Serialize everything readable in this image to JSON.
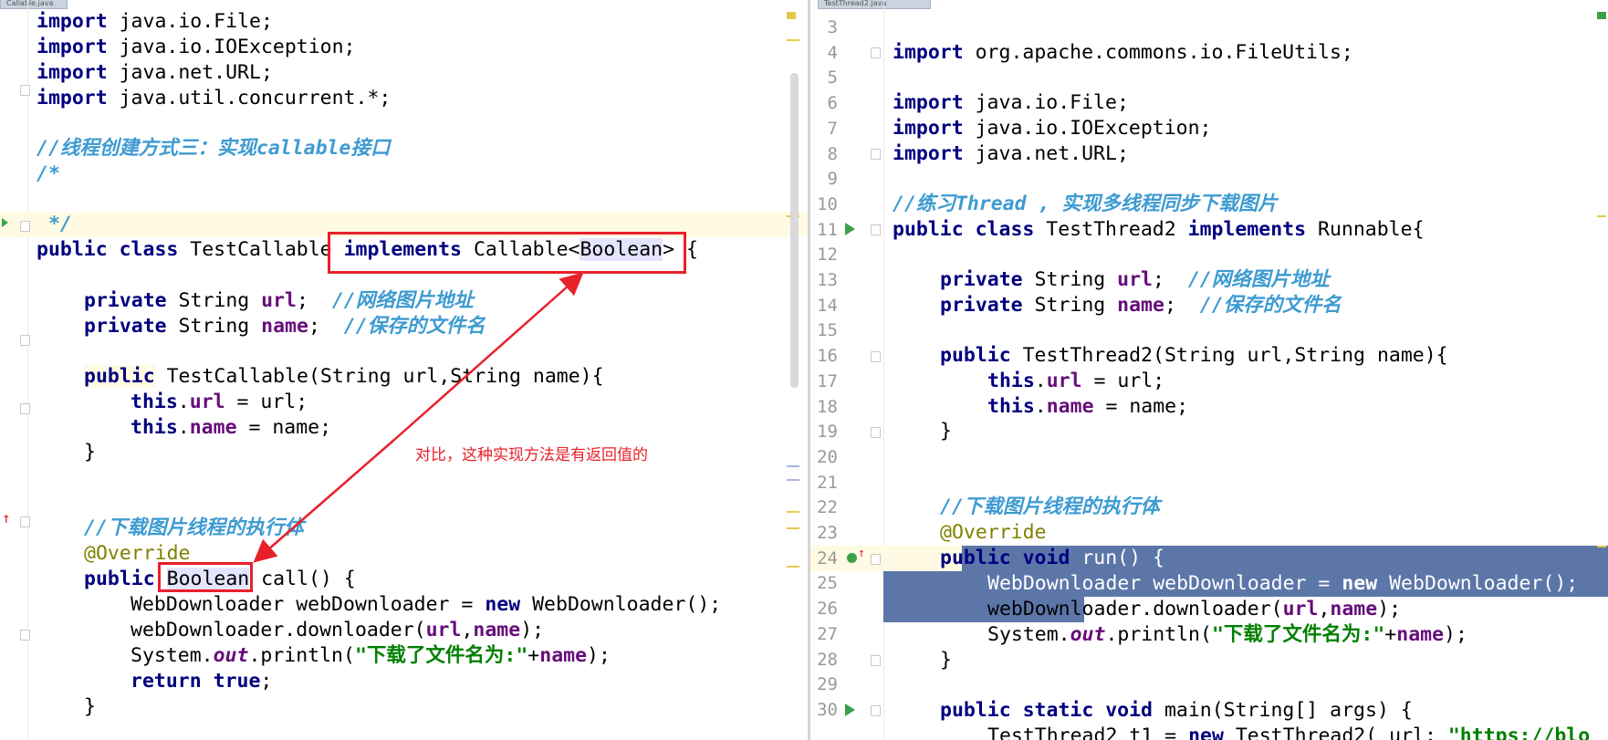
{
  "left_tab": {
    "label": "Callable.java"
  },
  "right_tab": {
    "label": "TestThread2.java"
  },
  "left": {
    "l1": [
      "import",
      " java.io.File;"
    ],
    "l2": [
      "import",
      " java.io.IOException;"
    ],
    "l3": [
      "import",
      " java.net.URL;"
    ],
    "l4": [
      "import",
      " java.util.concurrent.*;"
    ],
    "l6": "//线程创建方式三：实现callable接口",
    "l7": "/*",
    "l9": " */",
    "l10": [
      "public class",
      " TestCallable ",
      "implements",
      " Callable<",
      "Boolean",
      "> {"
    ],
    "l12": [
      "private",
      " String ",
      "url",
      ";  ",
      "//网络图片地址"
    ],
    "l13": [
      "private",
      " String ",
      "name",
      ";  ",
      "//保存的文件名"
    ],
    "l15": [
      "public",
      " TestCallable(String url,String name){"
    ],
    "l16": [
      "this",
      ".",
      "url",
      " = url;"
    ],
    "l17": [
      "this",
      ".",
      "name",
      " = name;"
    ],
    "l18": "}",
    "l21": "//下载图片线程的执行体",
    "l22": "@Override",
    "l23": [
      "public",
      " ",
      "Boolean",
      " call() {"
    ],
    "l24": [
      "WebDownloader webDownloader = ",
      "new",
      " WebDownloader();"
    ],
    "l25": [
      "webDownloader.downloader(",
      "url",
      ",",
      "name",
      ");"
    ],
    "l26": [
      "System.",
      "out",
      ".println(",
      "\"下载了文件名为:\"",
      "+",
      "name",
      ");"
    ],
    "l27": [
      "return",
      " ",
      "true",
      ";"
    ],
    "l28": "}",
    "annotation_note": "对比，这种实现方法是有返回值的"
  },
  "right": {
    "line_numbers": [
      "3",
      "4",
      "5",
      "6",
      "7",
      "8",
      "9",
      "10",
      "11",
      "12",
      "13",
      "14",
      "15",
      "16",
      "17",
      "18",
      "19",
      "20",
      "21",
      "22",
      "23",
      "24",
      "25",
      "26",
      "27",
      "28",
      "29",
      "30"
    ],
    "r4": [
      "import",
      " org.apache.commons.io.FileUtils;"
    ],
    "r6": [
      "import",
      " java.io.File;"
    ],
    "r7": [
      "import",
      " java.io.IOException;"
    ],
    "r8": [
      "import",
      " java.net.URL;"
    ],
    "r10": "//练习Thread , 实现多线程同步下载图片",
    "r11": [
      "public class",
      " TestThread2 ",
      "implements",
      " Runnable{"
    ],
    "r13": [
      "private",
      " String ",
      "url",
      ";  ",
      "//网络图片地址"
    ],
    "r14": [
      "private",
      " String ",
      "name",
      ";  ",
      "//保存的文件名"
    ],
    "r16": [
      "public",
      " TestThread2(String url,String name){"
    ],
    "r17": [
      "this",
      ".",
      "url",
      " = url;"
    ],
    "r18": [
      "this",
      ".",
      "name",
      " = name;"
    ],
    "r19": "}",
    "r22": "//下载图片线程的执行体",
    "r23": "@Override",
    "r24": [
      "public void",
      " run() {"
    ],
    "r25": [
      "WebDownloader webDownloader = ",
      "new",
      " WebDownloader();"
    ],
    "r26": [
      "webDownloader.downloader(",
      "url",
      ",",
      "name",
      ");"
    ],
    "r27": [
      "System.",
      "out",
      ".println(",
      "\"下载了文件名为:\"",
      "+",
      "name",
      ");"
    ],
    "r28": "}",
    "r30": [
      "public static void",
      " main(String[] args) {"
    ],
    "r31": [
      "TestThread2 t1 = ",
      "new",
      " TestThread2( url: ",
      "\"https://blo"
    ]
  },
  "colors": {
    "keyword": "#000080",
    "field": "#660e7a",
    "comment": "#3d9bd1",
    "string": "#008000",
    "annotation": "#808000",
    "selection": "#5c76a8",
    "callout": "#e8202a"
  }
}
